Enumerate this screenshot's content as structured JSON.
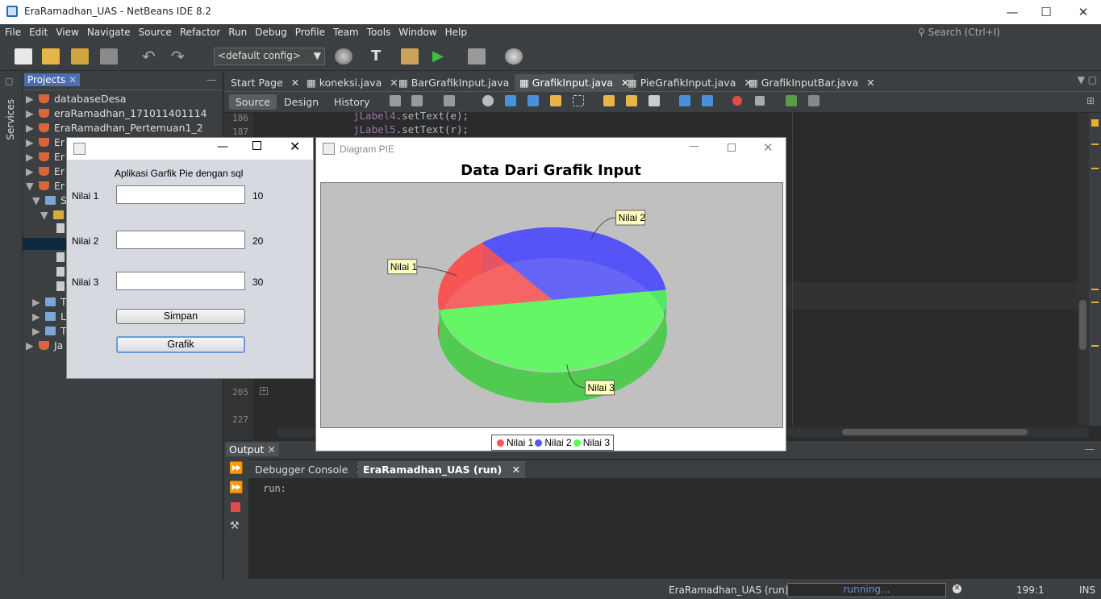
{
  "window": {
    "title": "EraRamadhan_UAS - NetBeans IDE 8.2"
  },
  "menu": [
    "File",
    "Edit",
    "View",
    "Navigate",
    "Source",
    "Refactor",
    "Run",
    "Debug",
    "Profile",
    "Team",
    "Tools",
    "Window",
    "Help"
  ],
  "search": {
    "placeholder": "Search (Ctrl+I)"
  },
  "toolbar": {
    "config": "<default config>"
  },
  "left_strip": {
    "services": "Services"
  },
  "projects": {
    "tab": "Projects",
    "items": [
      {
        "label": "databaseDesa",
        "expanded": false
      },
      {
        "label": "eraRamadhan_171011401114",
        "expanded": false
      },
      {
        "label": "EraRamadhan_Pertemuan1_2",
        "expanded": false
      },
      {
        "label": "Er",
        "expanded": false
      },
      {
        "label": "Er",
        "expanded": false
      },
      {
        "label": "Er",
        "expanded": false
      },
      {
        "label": "Er",
        "expanded": true
      },
      {
        "label": "S",
        "expanded": true
      },
      {
        "label": "",
        "expanded": true
      },
      {
        "label": "T",
        "expanded": false
      },
      {
        "label": "L",
        "expanded": false
      },
      {
        "label": "T",
        "expanded": false
      },
      {
        "label": "Ja",
        "expanded": false
      }
    ]
  },
  "editor": {
    "tabs": [
      "Start Page",
      "koneksi.java",
      "BarGrafikInput.java",
      "GrafikInput.java",
      "PieGrafikInput.java",
      "GrafikInputBar.java"
    ],
    "active_tab": "GrafikInput.java",
    "views": [
      "Source",
      "Design",
      "History"
    ],
    "lines": [
      {
        "n": "186",
        "obj": "jLabel4",
        "call": ".setText(e);"
      },
      {
        "n": "187",
        "obj": "jLabel5",
        "call": ".setText(r);"
      }
    ],
    "lower_line_numbers": [
      "205",
      "227"
    ]
  },
  "dialog_input": {
    "title": "Aplikasi Garfik Pie dengan sql",
    "fields": [
      {
        "label": "Nilai 1",
        "value": "",
        "display": "10"
      },
      {
        "label": "Nilai 2",
        "value": "",
        "display": "20"
      },
      {
        "label": "Nilai 3",
        "value": "",
        "display": "30"
      }
    ],
    "save_label": "Simpan",
    "chart_label": "Grafik"
  },
  "dialog_chart": {
    "window_title": "Diagram PIE"
  },
  "chart_data": {
    "type": "pie",
    "title": "Data Dari Grafik Input",
    "categories": [
      "Nilai 1",
      "Nilai 2",
      "Nilai 3"
    ],
    "values": [
      10,
      20,
      30
    ],
    "colors": [
      "#ff5555",
      "#5555ff",
      "#55ff55"
    ],
    "style": "3d",
    "legend": "bottom"
  },
  "output": {
    "title": "Output",
    "tabs": [
      "Debugger Console",
      "EraRamadhan_UAS (run)"
    ],
    "active_tab": "EraRamadhan_UAS (run)",
    "text": "run:"
  },
  "status": {
    "process": "EraRamadhan_UAS (run)",
    "progress": "running...",
    "position": "199:1",
    "mode": "INS"
  }
}
